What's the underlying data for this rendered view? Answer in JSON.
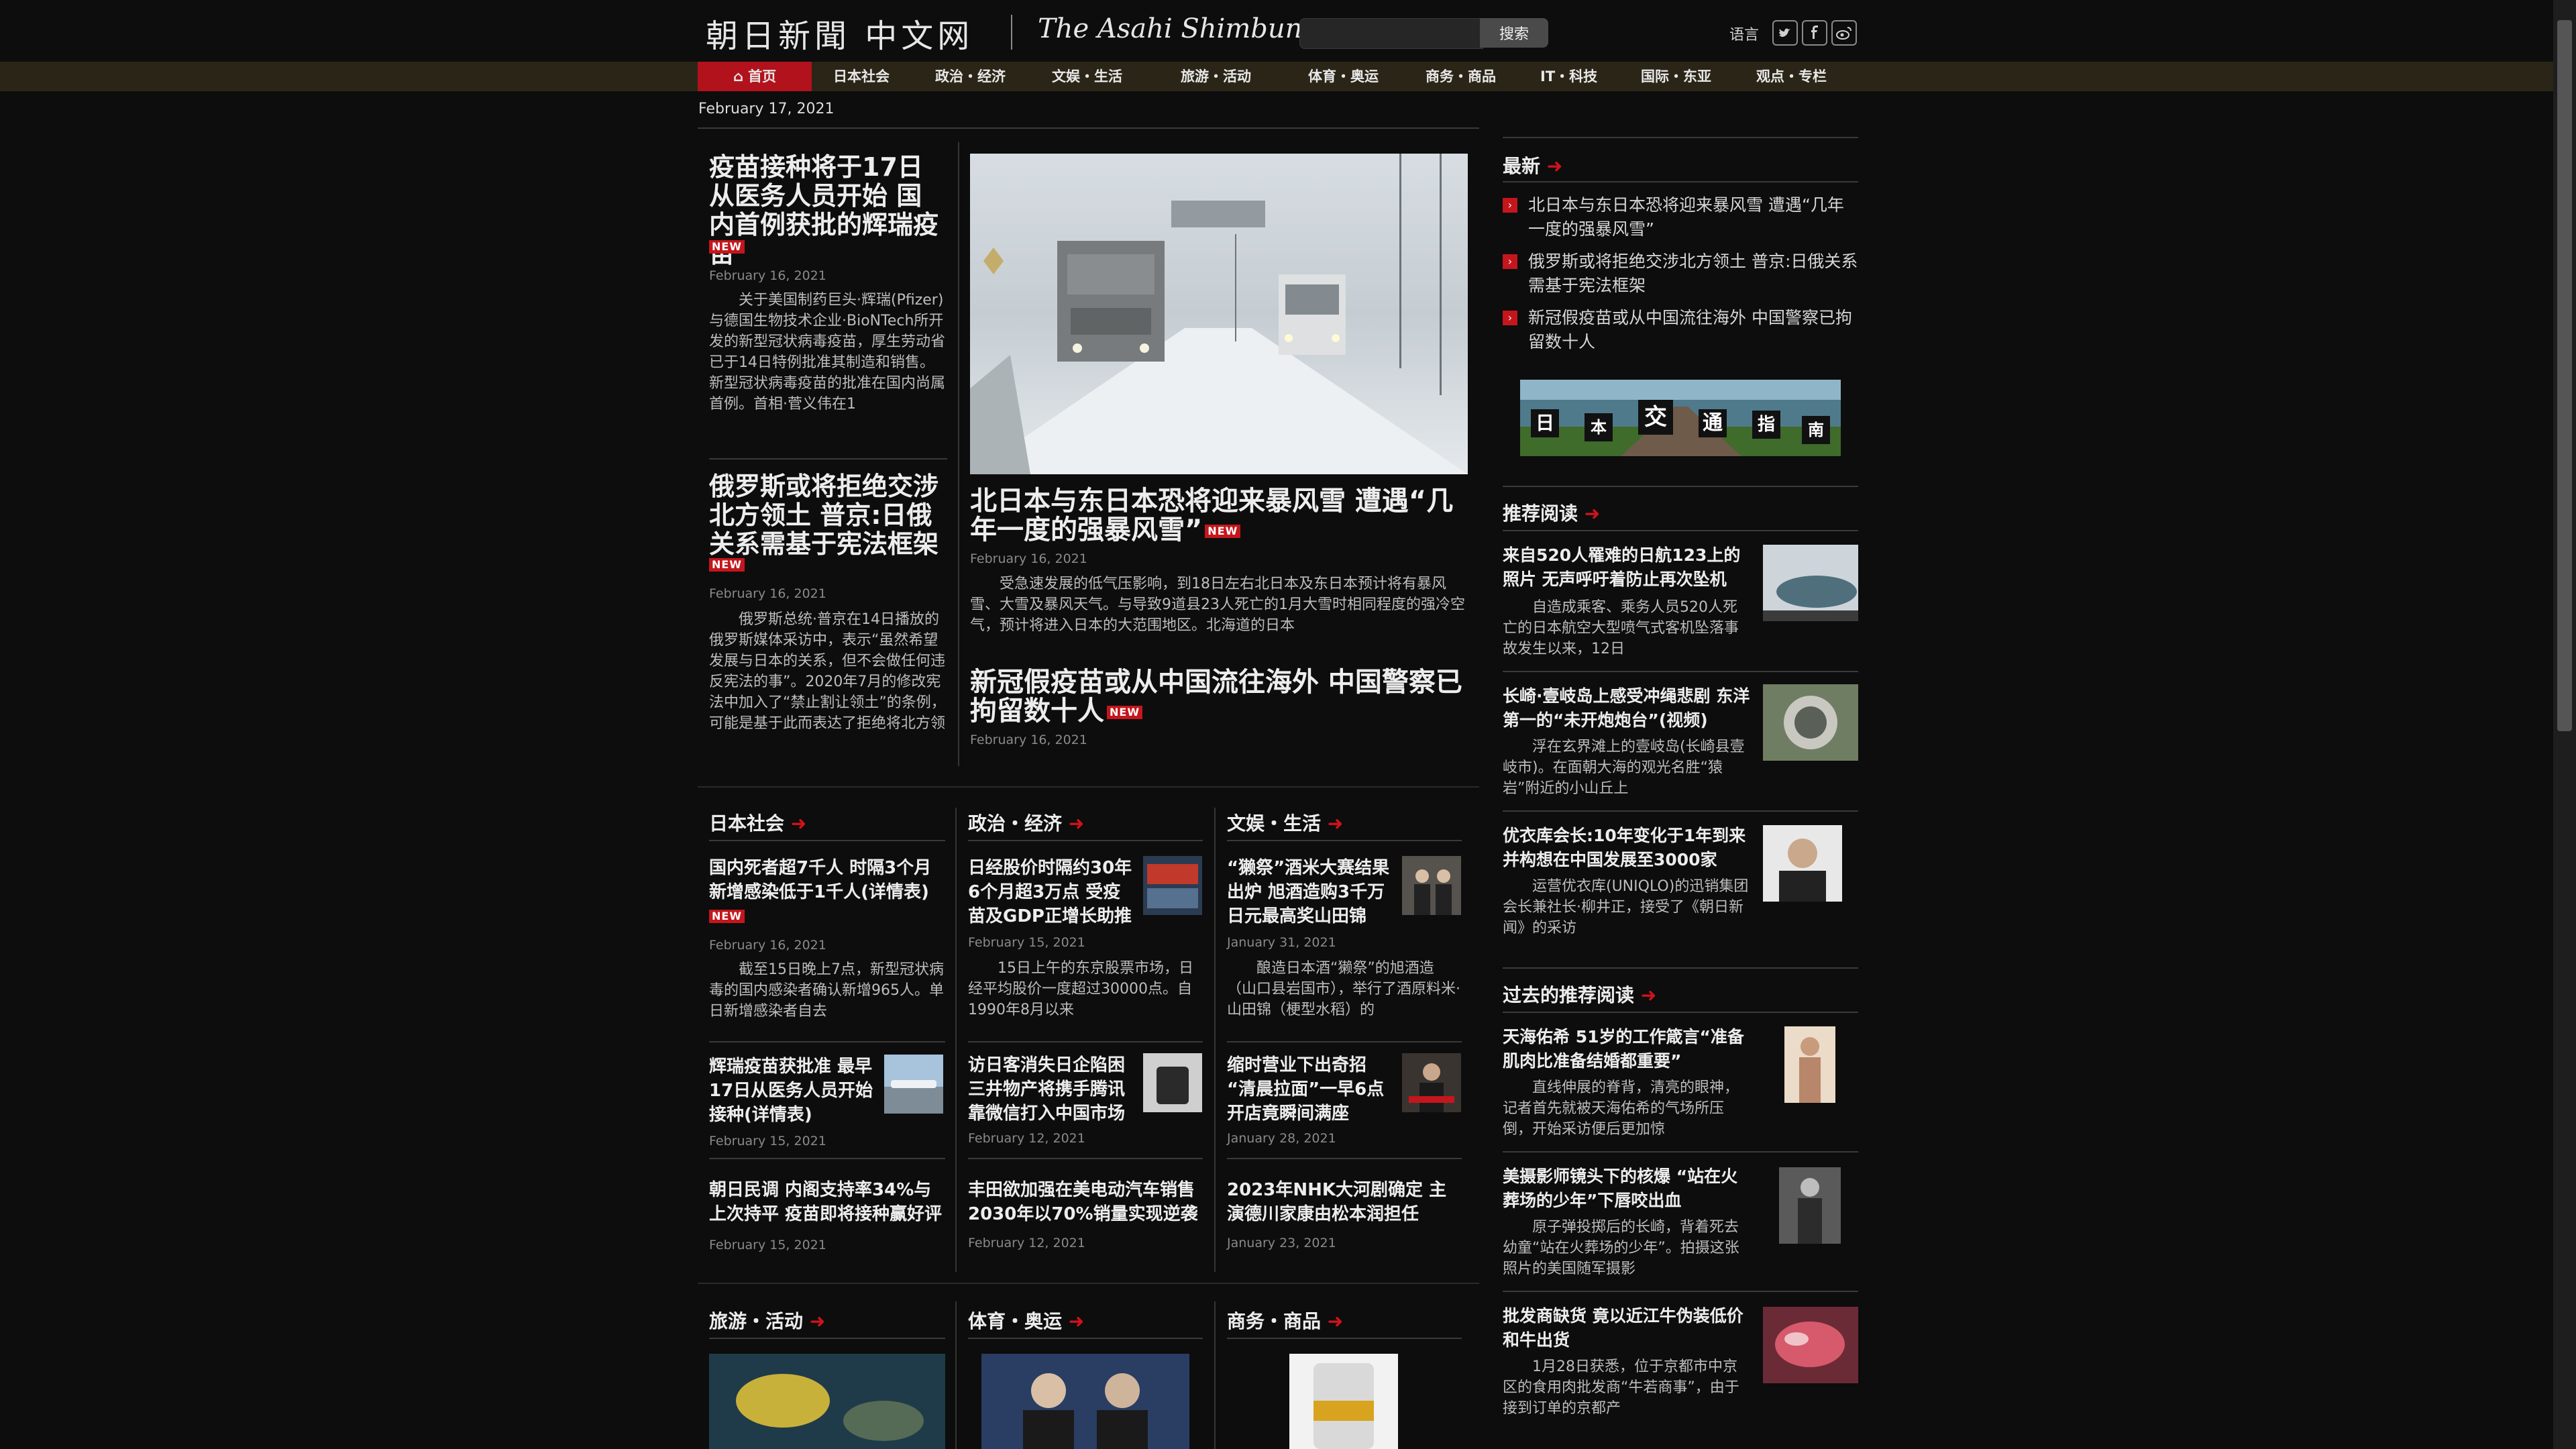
{
  "header": {
    "logo_cn": "朝日新聞 中文网",
    "logo_en": "The Asahi Shimbun",
    "search_button": "搜索",
    "search_placeholder": "",
    "language": "语言",
    "social_icons": [
      "twitter-icon",
      "facebook-icon",
      "weibo-icon"
    ]
  },
  "nav": {
    "items": [
      "首页",
      "日本社会",
      "政治・经济",
      "文娱・生活",
      "旅游・活动",
      "体育・奥运",
      "商务・商品",
      "IT・科技",
      "国际・东亚",
      "观点・专栏"
    ]
  },
  "page_date": "February 17, 2021",
  "new_badge": "NEW",
  "lead_left": [
    {
      "title": "疫苗接种将于17日从医务人员开始 国内首例获批的辉瑞疫苗",
      "date": "February 16, 2021",
      "summary": "关于美国制药巨头·辉瑞(Pfizer)与德国生物技术企业·BioNTech所开发的新型冠状病毒疫苗，厚生劳动省已于14日特例批准其制造和销售。新型冠状病毒疫苗的批准在国内尚属首例。首相·菅义伟在1"
    },
    {
      "title": "俄罗斯或将拒绝交涉北方领土 普京:日俄关系需基于宪法框架",
      "date": "February 16, 2021",
      "summary": "俄罗斯总统·普京在14日播放的俄罗斯媒体采访中，表示“虽然希望发展与日本的关系，但不会做任何违反宪法的事”。2020年7月的修改宪法中加入了“禁止割让领土”的条例，可能是基于此而表达了拒绝将北方领"
    }
  ],
  "lead_center": {
    "title": "北日本与东日本恐将迎来暴风雪 遭遇“几年一度的强暴风雪”",
    "date": "February 16, 2021",
    "summary": "受急速发展的低气压影响，到18日左右北日本及东日本预计将有暴风雪、大雪及暴风天气。与导致9道县23人死亡的1月大雪时相同程度的强冷空气，预计将进入日本的大范围地区。北海道的日本",
    "second_title": "新冠假疫苗或从中国流往海外 中国警察已拘留数十人",
    "second_date": "February 16, 2021"
  },
  "sections": [
    {
      "title": "日本社会",
      "articles": [
        {
          "title": "国内死者超7千人 时隔3个月新增感染低于1千人(详情表)",
          "date": "February 16, 2021",
          "summary": "截至15日晚上7点，新型冠状病毒的国内感染者确认新增965人。单日新增感染者自去"
        },
        {
          "title": "辉瑞疫苗获批准 最早17日从医务人员开始接种(详情表)",
          "date": "February 15, 2021"
        },
        {
          "title": "朝日民调 内阁支持率34%与上次持平 疫苗即将接种赢好评",
          "date": "February 15, 2021"
        }
      ]
    },
    {
      "title": "政治・经济",
      "articles": [
        {
          "title": "日经股价时隔约30年6个月超3万点 受疫苗及GDP正增长助推",
          "date": "February 15, 2021",
          "summary": "15日上午的东京股票市场，日经平均股价一度超过30000点。自1990年8月以来"
        },
        {
          "title": "访日客消失日企陷困 三井物产将携手腾讯靠微信打入中国市场",
          "date": "February 12, 2021"
        },
        {
          "title": "丰田欲加强在美电动汽车销售 2030年以70%销量实现逆袭",
          "date": "February 12, 2021"
        }
      ]
    },
    {
      "title": "文娱・生活",
      "articles": [
        {
          "title": "“獭祭”酒米大赛结果出炉 旭酒造购3千万日元最高奖山田锦",
          "date": "January 31, 2021",
          "summary": "酿造日本酒“獭祭”的旭酒造（山口县岩国市），举行了酒原料米·山田锦（梗型水稻）的"
        },
        {
          "title": "缩时营业下出奇招 “清晨拉面”一早6点开店竟瞬间满座",
          "date": "January 28, 2021"
        },
        {
          "title": "2023年NHK大河剧确定 主演德川家康由松本润担任",
          "date": "January 23, 2021"
        }
      ]
    }
  ],
  "bottom_sections": [
    "旅游・活动",
    "体育・奥运",
    "商务・商品"
  ],
  "sidebar": {
    "latest_title": "最新",
    "latest": [
      "北日本与东日本恐将迎来暴风雪 遭遇“几年一度的强暴风雪”",
      "俄罗斯或将拒绝交涉北方领土 普京:日俄关系需基于宪法框架",
      "新冠假疫苗或从中国流往海外 中国警察已拘留数十人"
    ],
    "banner_chars": [
      "日",
      "本",
      "交",
      "通",
      "指",
      "南"
    ],
    "recommended_title": "推荐阅读",
    "recommended": [
      {
        "title": "来自520人罹难的日航123上的照片 无声呼吁着防止再次坠机",
        "summary": "自造成乘客、乘务人员520人死亡的日本航空大型喷气式客机坠落事故发生以来，12日"
      },
      {
        "title": "长崎·壹岐岛上感受冲绳悲剧 东洋第一的“未开炮炮台”(视频)",
        "summary": "浮在玄界滩上的壹岐岛(长崎县壹岐市)。在面朝大海的观光名胜“猿岩”附近的小山丘上"
      },
      {
        "title": "优衣库会长:10年变化于1年到来 并构想在中国发展至3000家",
        "summary": "运营优衣库(UNIQLO)的迅销集团会长兼社长·柳井正，接受了《朝日新闻》的采访"
      }
    ],
    "past_title": "过去的推荐阅读",
    "past": [
      {
        "title": "天海佑希 51岁的工作箴言“准备肌肉比准备结婚都重要”",
        "summary": "直线伸展的脊背，清亮的眼神，记者首先就被天海佑希的气场所压倒，开始采访便后更加惊"
      },
      {
        "title": "美摄影师镜头下的核爆 “站在火葬场的少年”下唇咬出血",
        "summary": "原子弹投掷后的长崎，背着死去幼童“站在火葬场的少年”。拍摄这张照片的美国随军摄影"
      },
      {
        "title": "批发商缺货 竟以近江牛伪装低价和牛出货",
        "summary": "1月28日获悉，位于京都市中京区的食用肉批发商“牛若商事”，由于接到订单的京都产"
      }
    ]
  }
}
